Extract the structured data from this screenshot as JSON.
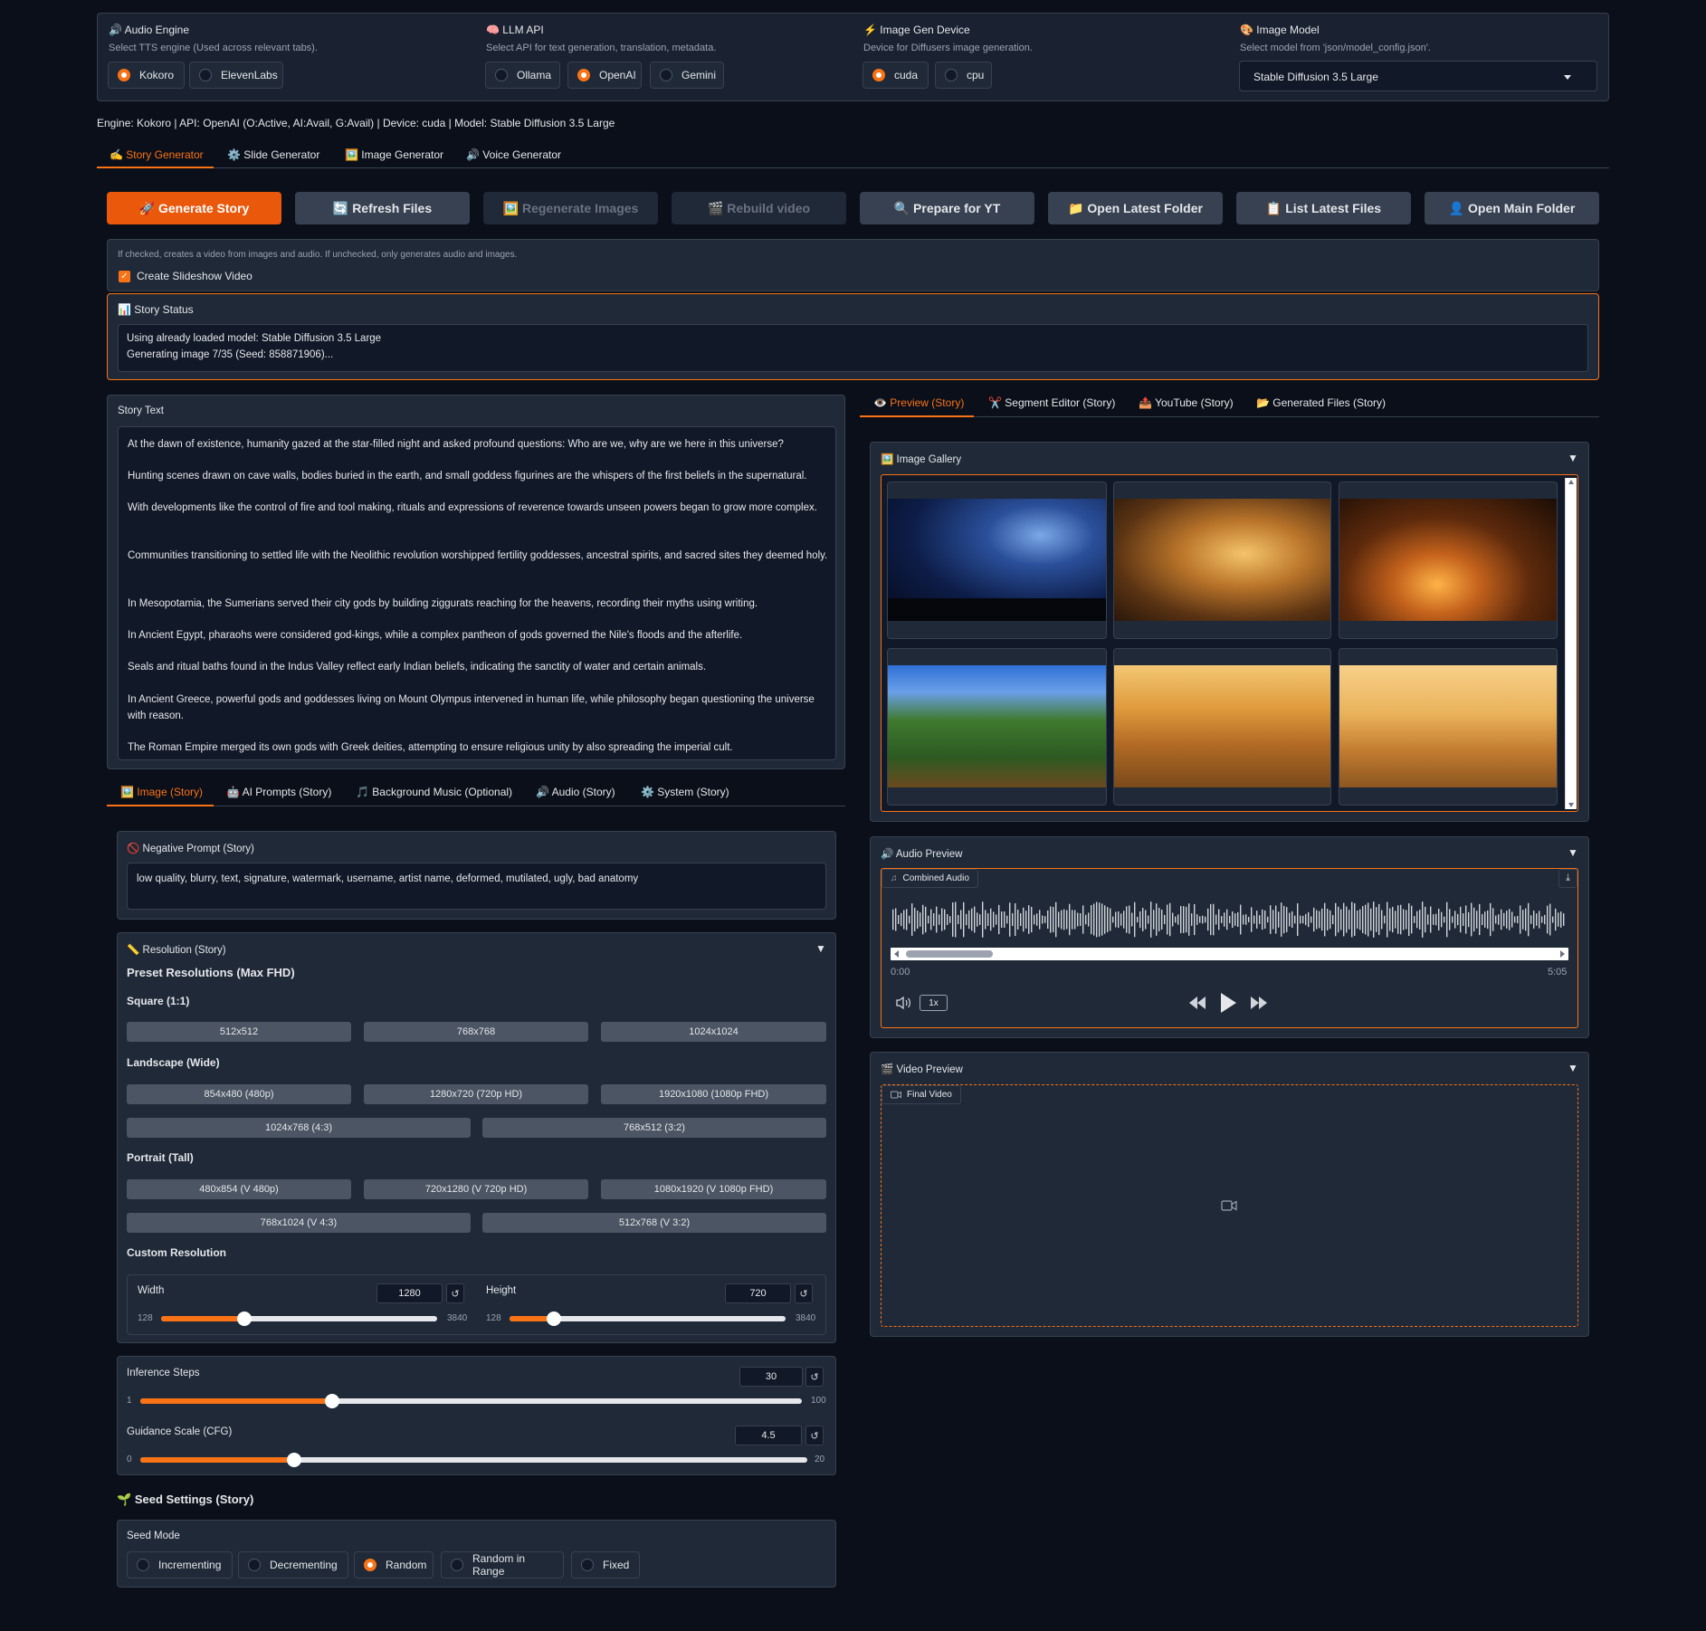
{
  "settings": {
    "audio_engine": {
      "icon": "🔊",
      "title": "Audio Engine",
      "info": "Select TTS engine (Used across relevant tabs).",
      "options": [
        "Kokoro",
        "ElevenLabs"
      ],
      "selected": "Kokoro"
    },
    "llm_api": {
      "icon": "🧠",
      "title": "LLM API",
      "info": "Select API for text generation, translation, metadata.",
      "options": [
        "Ollama",
        "OpenAI",
        "Gemini"
      ],
      "selected": "OpenAI"
    },
    "device": {
      "icon": "⚡",
      "title": "Image Gen Device",
      "info": "Device for Diffusers image generation.",
      "options": [
        "cuda",
        "cpu"
      ],
      "selected": "cuda"
    },
    "image_model": {
      "icon": "🎨",
      "title": "Image Model",
      "info": "Select model from 'json/model_config.json'.",
      "value": "Stable Diffusion 3.5 Large"
    }
  },
  "status_line": "Engine: Kokoro | API: OpenAI (O:Active, AI:Avail, G:Avail) | Device: cuda | Model: Stable Diffusion 3.5 Large",
  "main_tabs": [
    {
      "icon": "✍️",
      "label": "Story Generator"
    },
    {
      "icon": "⚙️",
      "label": "Slide Generator"
    },
    {
      "icon": "🖼️",
      "label": "Image Generator"
    },
    {
      "icon": "🔊",
      "label": "Voice Generator"
    }
  ],
  "actions": [
    {
      "icon": "🚀",
      "label": "Generate Story"
    },
    {
      "icon": "🔄",
      "label": "Refresh Files"
    },
    {
      "icon": "🖼️",
      "label": "Regenerate Images"
    },
    {
      "icon": "🎬",
      "label": "Rebuild video"
    },
    {
      "icon": "🔍",
      "label": "Prepare for YT"
    },
    {
      "icon": "📁",
      "label": "Open Latest Folder"
    },
    {
      "icon": "📋",
      "label": "List Latest Files"
    },
    {
      "icon": "👤",
      "label": "Open Main Folder"
    }
  ],
  "slideshow": {
    "info": "If checked, creates a video from images and audio. If unchecked, only generates audio and images.",
    "label": "Create Slideshow Video",
    "checked": true
  },
  "story_status": {
    "icon": "📊",
    "title": "Story Status",
    "lines": [
      "Using already loaded model: Stable Diffusion 3.5 Large",
      "Generating image 7/35 (Seed: 858871906)..."
    ]
  },
  "story_text": {
    "title": "Story Text",
    "paragraphs": [
      "At the dawn of existence, humanity gazed at the star-filled night and asked profound questions: Who are we, why are we here in this universe?",
      "Hunting scenes drawn on cave walls, bodies buried in the earth, and small goddess figurines are the whispers of the first beliefs in the supernatural.",
      "With developments like the control of fire and tool making, rituals and expressions of reverence towards unseen powers began to grow more complex.",
      "Communities transitioning to settled life with the Neolithic revolution worshipped fertility goddesses, ancestral spirits, and sacred sites they deemed holy.",
      "In Mesopotamia, the Sumerians served their city gods by building ziggurats reaching for the heavens, recording their myths using writing.",
      "In Ancient Egypt, pharaohs were considered god-kings, while a complex pantheon of gods governed the Nile's floods and the afterlife.",
      "Seals and ritual baths found in the Indus Valley reflect early Indian beliefs, indicating the sanctity of water and certain animals.",
      "In Ancient Greece, powerful gods and goddesses living on Mount Olympus intervened in human life, while philosophy began questioning the universe with reason.",
      "The Roman Empire merged its own gods with Greek deities, attempting to ensure religious unity by also spreading the imperial cult."
    ]
  },
  "sub_tabs": [
    {
      "icon": "🖼️",
      "label": "Image (Story)"
    },
    {
      "icon": "🤖",
      "label": "AI Prompts (Story)"
    },
    {
      "icon": "🎵",
      "label": "Background Music (Optional)"
    },
    {
      "icon": "🔊",
      "label": "Audio (Story)"
    },
    {
      "icon": "⚙️",
      "label": "System (Story)"
    }
  ],
  "negative_prompt": {
    "icon": "🚫",
    "title": "Negative Prompt (Story)",
    "value": "low quality, blurry, text, signature, watermark, username, artist name, deformed, mutilated, ugly, bad anatomy"
  },
  "resolution": {
    "icon": "📏",
    "title": "Resolution (Story)",
    "preset_heading": "Preset Resolutions (Max FHD)",
    "square_heading": "Square (1:1)",
    "square": [
      "512x512",
      "768x768",
      "1024x1024"
    ],
    "landscape_heading": "Landscape (Wide)",
    "landscape_row1": [
      "854x480 (480p)",
      "1280x720 (720p HD)",
      "1920x1080 (1080p FHD)"
    ],
    "landscape_row2": [
      "1024x768 (4:3)",
      "768x512 (3:2)"
    ],
    "portrait_heading": "Portrait (Tall)",
    "portrait_row1": [
      "480x854 (V 480p)",
      "720x1280 (V 720p HD)",
      "1080x1920 (V 1080p FHD)"
    ],
    "portrait_row2": [
      "768x1024 (V 4:3)",
      "512x768 (V 3:2)"
    ],
    "custom_heading": "Custom Resolution",
    "width": {
      "label": "Width",
      "value": "1280",
      "min": "128",
      "max": "3840",
      "fraction": 0.3
    },
    "height": {
      "label": "Height",
      "value": "720",
      "min": "128",
      "max": "3840",
      "fraction": 0.16
    }
  },
  "inference": {
    "label": "Inference Steps",
    "value": "30",
    "min": "1",
    "max": "100",
    "fraction": 0.29
  },
  "guidance": {
    "label": "Guidance Scale (CFG)",
    "value": "4.5",
    "min": "0",
    "max": "20",
    "fraction": 0.23
  },
  "seed": {
    "icon": "🌱",
    "title": "Seed Settings (Story)",
    "mode_label": "Seed Mode",
    "options": [
      "Incrementing",
      "Decrementing",
      "Random",
      "Random in Range",
      "Fixed"
    ],
    "selected": "Random"
  },
  "right_tabs": [
    {
      "icon": "👁️",
      "label": "Preview (Story)"
    },
    {
      "icon": "✂️",
      "label": "Segment Editor (Story)"
    },
    {
      "icon": "📤",
      "label": "YouTube (Story)"
    },
    {
      "icon": "📂",
      "label": "Generated Files (Story)"
    }
  ],
  "gallery": {
    "icon": "🖼️",
    "title": "Image Gallery"
  },
  "audio_preview": {
    "icon": "🔊",
    "title": "Audio Preview",
    "label": "Combined Audio",
    "time_start": "0:00",
    "time_end": "5:05",
    "speed": "1x"
  },
  "video_preview": {
    "icon": "🎬",
    "title": "Video Preview",
    "label": "Final Video"
  },
  "colors": {
    "accent": "#f97316",
    "background": "#0b0f19",
    "panel": "#1f2937",
    "block": "#111827"
  }
}
